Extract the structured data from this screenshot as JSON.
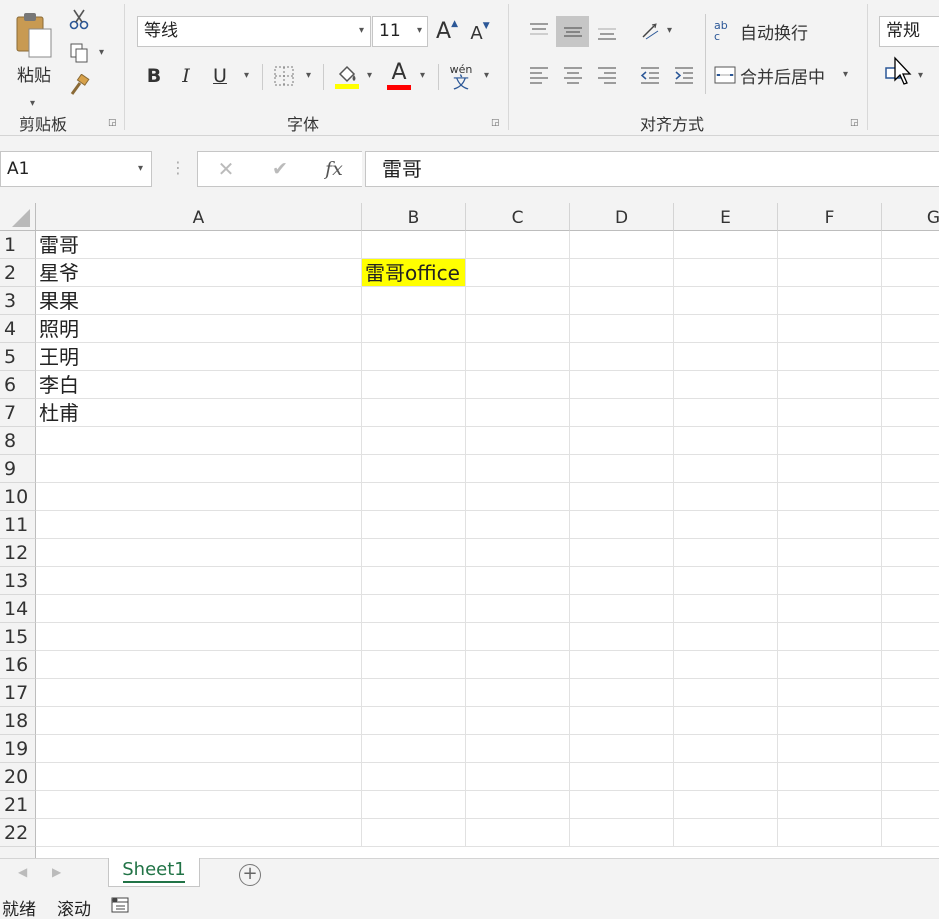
{
  "ribbon": {
    "clipboard": {
      "paste_label": "粘贴",
      "group_label": "剪贴板"
    },
    "font": {
      "font_name": "等线",
      "font_size": "11",
      "bold": "B",
      "italic": "I",
      "underline": "U",
      "font_color_letter": "A",
      "grow_font": "A",
      "shrink_font": "A",
      "phonetic_top": "wén",
      "phonetic_bottom": "文",
      "group_label": "字体",
      "fill_color": "#ffff00",
      "font_color": "#ff0000"
    },
    "alignment": {
      "wrap_text_label": "自动换行",
      "wrap_text_icon": "ab c",
      "merge_center_label": "合并后居中",
      "group_label": "对齐方式"
    },
    "number": {
      "format_value": "常规"
    }
  },
  "formula_bar": {
    "name_box": "A1",
    "cancel": "✕",
    "enter": "✔",
    "fx": "fx",
    "content": "雷哥"
  },
  "grid": {
    "columns": [
      "A",
      "B",
      "C",
      "D",
      "E",
      "F",
      "G"
    ],
    "rows": [
      "1",
      "2",
      "3",
      "4",
      "5",
      "6",
      "7",
      "8",
      "9",
      "10",
      "11",
      "12",
      "13",
      "14",
      "15",
      "16",
      "17",
      "18",
      "19",
      "20",
      "21",
      "22"
    ],
    "col_a_values": [
      "雷哥",
      "星爷",
      "果果",
      "照明",
      "王明",
      "李白",
      "杜甫"
    ],
    "b2_value": "雷哥office",
    "b2_fill": "#ffff00"
  },
  "sheet_tabs": {
    "active_tab": "Sheet1",
    "add_icon": "+"
  },
  "status_bar": {
    "ready": "就绪",
    "scroll": "滚动"
  }
}
